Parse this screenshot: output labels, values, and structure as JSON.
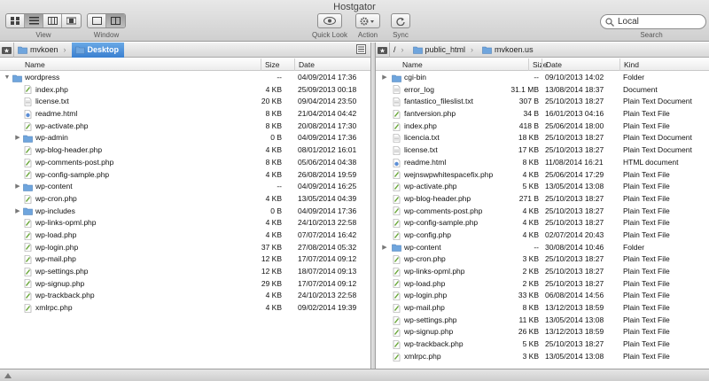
{
  "window": {
    "title": "Hostgator"
  },
  "toolbar": {
    "view_label": "View",
    "window_label": "Window",
    "quicklook_label": "Quick Look",
    "action_label": "Action",
    "sync_label": "Sync",
    "search_label": "Search",
    "search_value": "Local"
  },
  "left": {
    "path": [
      {
        "label": "mvkoen",
        "selected": false
      },
      {
        "label": "Desktop",
        "selected": true
      }
    ],
    "columns": {
      "name": "Name",
      "size": "Size",
      "date": "Date"
    },
    "rows": [
      {
        "name": "wordpress",
        "size": "--",
        "date": "04/09/2014 17:36",
        "icon": "folder",
        "indent": 0,
        "disc": "open"
      },
      {
        "name": "index.php",
        "size": "4 KB",
        "date": "25/09/2013 00:18",
        "icon": "php",
        "indent": 1,
        "disc": ""
      },
      {
        "name": "license.txt",
        "size": "20 KB",
        "date": "09/04/2014 23:50",
        "icon": "txt",
        "indent": 1,
        "disc": ""
      },
      {
        "name": "readme.html",
        "size": "8 KB",
        "date": "21/04/2014 04:42",
        "icon": "html",
        "indent": 1,
        "disc": ""
      },
      {
        "name": "wp-activate.php",
        "size": "8 KB",
        "date": "20/08/2014 17:30",
        "icon": "php",
        "indent": 1,
        "disc": ""
      },
      {
        "name": "wp-admin",
        "size": "0 B",
        "date": "04/09/2014 17:36",
        "icon": "folder",
        "indent": 1,
        "disc": "closed"
      },
      {
        "name": "wp-blog-header.php",
        "size": "4 KB",
        "date": "08/01/2012 16:01",
        "icon": "php",
        "indent": 1,
        "disc": ""
      },
      {
        "name": "wp-comments-post.php",
        "size": "8 KB",
        "date": "05/06/2014 04:38",
        "icon": "php",
        "indent": 1,
        "disc": ""
      },
      {
        "name": "wp-config-sample.php",
        "size": "4 KB",
        "date": "26/08/2014 19:59",
        "icon": "php",
        "indent": 1,
        "disc": ""
      },
      {
        "name": "wp-content",
        "size": "--",
        "date": "04/09/2014 16:25",
        "icon": "folder",
        "indent": 1,
        "disc": "closed"
      },
      {
        "name": "wp-cron.php",
        "size": "4 KB",
        "date": "13/05/2014 04:39",
        "icon": "php",
        "indent": 1,
        "disc": ""
      },
      {
        "name": "wp-includes",
        "size": "0 B",
        "date": "04/09/2014 17:36",
        "icon": "folder",
        "indent": 1,
        "disc": "closed"
      },
      {
        "name": "wp-links-opml.php",
        "size": "4 KB",
        "date": "24/10/2013 22:58",
        "icon": "php",
        "indent": 1,
        "disc": ""
      },
      {
        "name": "wp-load.php",
        "size": "4 KB",
        "date": "07/07/2014 16:42",
        "icon": "php",
        "indent": 1,
        "disc": ""
      },
      {
        "name": "wp-login.php",
        "size": "37 KB",
        "date": "27/08/2014 05:32",
        "icon": "php",
        "indent": 1,
        "disc": ""
      },
      {
        "name": "wp-mail.php",
        "size": "12 KB",
        "date": "17/07/2014 09:12",
        "icon": "php",
        "indent": 1,
        "disc": ""
      },
      {
        "name": "wp-settings.php",
        "size": "12 KB",
        "date": "18/07/2014 09:13",
        "icon": "php",
        "indent": 1,
        "disc": ""
      },
      {
        "name": "wp-signup.php",
        "size": "29 KB",
        "date": "17/07/2014 09:12",
        "icon": "php",
        "indent": 1,
        "disc": ""
      },
      {
        "name": "wp-trackback.php",
        "size": "4 KB",
        "date": "24/10/2013 22:58",
        "icon": "php",
        "indent": 1,
        "disc": ""
      },
      {
        "name": "xmlrpc.php",
        "size": "4 KB",
        "date": "09/02/2014 19:39",
        "icon": "php",
        "indent": 1,
        "disc": ""
      }
    ]
  },
  "right": {
    "path": [
      {
        "label": "/",
        "selected": false
      },
      {
        "label": "public_html",
        "selected": false
      },
      {
        "label": "mvkoen.us",
        "selected": false
      }
    ],
    "columns": {
      "name": "Name",
      "size": "Size",
      "date": "Date",
      "kind": "Kind"
    },
    "rows": [
      {
        "name": "cgi-bin",
        "size": "--",
        "date": "09/10/2013 14:02",
        "kind": "Folder",
        "icon": "folder",
        "disc": "closed"
      },
      {
        "name": "error_log",
        "size": "31.1 MB",
        "date": "13/08/2014 18:37",
        "kind": "Document",
        "icon": "doc",
        "disc": ""
      },
      {
        "name": "fantastico_fileslist.txt",
        "size": "307 B",
        "date": "25/10/2013 18:27",
        "kind": "Plain Text Document",
        "icon": "txt",
        "disc": ""
      },
      {
        "name": "fantversion.php",
        "size": "34 B",
        "date": "16/01/2013 04:16",
        "kind": "Plain Text File",
        "icon": "php",
        "disc": ""
      },
      {
        "name": "index.php",
        "size": "418 B",
        "date": "25/06/2014 18:00",
        "kind": "Plain Text File",
        "icon": "php",
        "disc": ""
      },
      {
        "name": "licencia.txt",
        "size": "18 KB",
        "date": "25/10/2013 18:27",
        "kind": "Plain Text Document",
        "icon": "txt",
        "disc": ""
      },
      {
        "name": "license.txt",
        "size": "17 KB",
        "date": "25/10/2013 18:27",
        "kind": "Plain Text Document",
        "icon": "txt",
        "disc": ""
      },
      {
        "name": "readme.html",
        "size": "8 KB",
        "date": "11/08/2014 16:21",
        "kind": "HTML document",
        "icon": "html",
        "disc": ""
      },
      {
        "name": "wejnswpwhitespacefix.php",
        "size": "4 KB",
        "date": "25/06/2014 17:29",
        "kind": "Plain Text File",
        "icon": "php",
        "disc": ""
      },
      {
        "name": "wp-activate.php",
        "size": "5 KB",
        "date": "13/05/2014 13:08",
        "kind": "Plain Text File",
        "icon": "php",
        "disc": ""
      },
      {
        "name": "wp-blog-header.php",
        "size": "271 B",
        "date": "25/10/2013 18:27",
        "kind": "Plain Text File",
        "icon": "php",
        "disc": ""
      },
      {
        "name": "wp-comments-post.php",
        "size": "4 KB",
        "date": "25/10/2013 18:27",
        "kind": "Plain Text File",
        "icon": "php",
        "disc": ""
      },
      {
        "name": "wp-config-sample.php",
        "size": "4 KB",
        "date": "25/10/2013 18:27",
        "kind": "Plain Text File",
        "icon": "php",
        "disc": ""
      },
      {
        "name": "wp-config.php",
        "size": "4 KB",
        "date": "02/07/2014 20:43",
        "kind": "Plain Text File",
        "icon": "php",
        "disc": ""
      },
      {
        "name": "wp-content",
        "size": "--",
        "date": "30/08/2014 10:46",
        "kind": "Folder",
        "icon": "folder",
        "disc": "closed"
      },
      {
        "name": "wp-cron.php",
        "size": "3 KB",
        "date": "25/10/2013 18:27",
        "kind": "Plain Text File",
        "icon": "php",
        "disc": ""
      },
      {
        "name": "wp-links-opml.php",
        "size": "2 KB",
        "date": "25/10/2013 18:27",
        "kind": "Plain Text File",
        "icon": "php",
        "disc": ""
      },
      {
        "name": "wp-load.php",
        "size": "2 KB",
        "date": "25/10/2013 18:27",
        "kind": "Plain Text File",
        "icon": "php",
        "disc": ""
      },
      {
        "name": "wp-login.php",
        "size": "33 KB",
        "date": "06/08/2014 14:56",
        "kind": "Plain Text File",
        "icon": "php",
        "disc": ""
      },
      {
        "name": "wp-mail.php",
        "size": "8 KB",
        "date": "13/12/2013 18:59",
        "kind": "Plain Text File",
        "icon": "php",
        "disc": ""
      },
      {
        "name": "wp-settings.php",
        "size": "11 KB",
        "date": "13/05/2014 13:08",
        "kind": "Plain Text File",
        "icon": "php",
        "disc": ""
      },
      {
        "name": "wp-signup.php",
        "size": "26 KB",
        "date": "13/12/2013 18:59",
        "kind": "Plain Text File",
        "icon": "php",
        "disc": ""
      },
      {
        "name": "wp-trackback.php",
        "size": "5 KB",
        "date": "25/10/2013 18:27",
        "kind": "Plain Text File",
        "icon": "php",
        "disc": ""
      },
      {
        "name": "xmlrpc.php",
        "size": "3 KB",
        "date": "13/05/2014 13:08",
        "kind": "Plain Text File",
        "icon": "php",
        "disc": ""
      }
    ]
  },
  "colors": {
    "folder": "#6fa5dd",
    "selected_crumb": "#3a7fd0",
    "php_icon": "#6aa83a"
  }
}
